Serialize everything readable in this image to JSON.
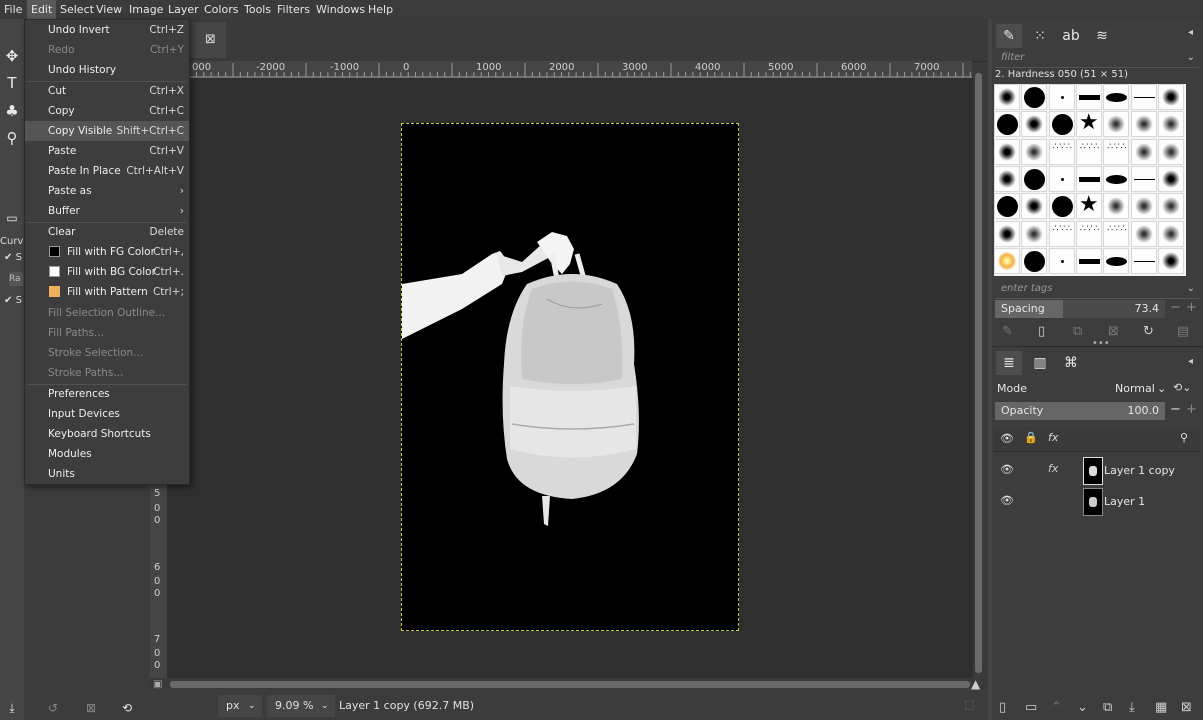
{
  "menubar": {
    "items": [
      "File",
      "Edit",
      "Select",
      "View",
      "Image",
      "Layer",
      "Colors",
      "Tools",
      "Filters",
      "Windows",
      "Help"
    ],
    "active": "Edit"
  },
  "edit_menu": {
    "undo": {
      "label": "Undo Invert",
      "shortcut": "Ctrl+Z"
    },
    "redo": {
      "label": "Redo",
      "shortcut": "Ctrl+Y"
    },
    "undo_history": {
      "label": "Undo History"
    },
    "cut": {
      "label": "Cut",
      "shortcut": "Ctrl+X"
    },
    "copy": {
      "label": "Copy",
      "shortcut": "Ctrl+C"
    },
    "copy_visible": {
      "label": "Copy Visible",
      "shortcut": "Shift+Ctrl+C"
    },
    "paste": {
      "label": "Paste",
      "shortcut": "Ctrl+V"
    },
    "paste_in_place": {
      "label": "Paste In Place",
      "shortcut": "Ctrl+Alt+V"
    },
    "paste_as": {
      "label": "Paste as"
    },
    "buffer": {
      "label": "Buffer"
    },
    "clear": {
      "label": "Clear",
      "shortcut": "Delete"
    },
    "fill_fg": {
      "label": "Fill with FG Color",
      "shortcut": "Ctrl+,"
    },
    "fill_bg": {
      "label": "Fill with BG Color",
      "shortcut": "Ctrl+."
    },
    "fill_pattern": {
      "label": "Fill with Pattern",
      "shortcut": "Ctrl+;"
    },
    "fill_selection_outline": {
      "label": "Fill Selection Outline..."
    },
    "fill_paths": {
      "label": "Fill Paths..."
    },
    "stroke_selection": {
      "label": "Stroke Selection..."
    },
    "stroke_paths": {
      "label": "Stroke Paths..."
    },
    "preferences": {
      "label": "Preferences"
    },
    "input_devices": {
      "label": "Input Devices"
    },
    "keyboard_shortcuts": {
      "label": "Keyboard Shortcuts"
    },
    "modules": {
      "label": "Modules"
    },
    "units": {
      "label": "Units"
    }
  },
  "colors": {
    "fg": "#000000",
    "bg": "#ffffff",
    "pattern": "#f0b060"
  },
  "left_panel": {
    "curves_label": "Curve",
    "s1": "S",
    "ra": "Ra",
    "s2": "S"
  },
  "rulers": {
    "h_ticks": [
      "000",
      "-2000",
      "-1000",
      "0",
      "1000",
      "2000",
      "3000",
      "4000",
      "5000",
      "6000",
      "7000"
    ],
    "v_ticks": [
      "5",
      "0",
      "0",
      "6",
      "0",
      "0",
      "7",
      "0",
      "0"
    ]
  },
  "statusbar": {
    "unit": "px",
    "zoom": "9.09 %",
    "info": "Layer 1 copy (692.7 MB)"
  },
  "brushes": {
    "filter_placeholder": "filter",
    "selected": "2. Hardness 050 (51 × 51)",
    "tags_placeholder": "enter tags",
    "spacing_label": "Spacing",
    "spacing_value": "73.4"
  },
  "layers": {
    "mode_label": "Mode",
    "mode_value": "Normal",
    "opacity_label": "Opacity",
    "opacity_value": "100.0",
    "items": [
      {
        "name": "Layer 1 copy"
      },
      {
        "name": "Layer 1"
      }
    ]
  }
}
